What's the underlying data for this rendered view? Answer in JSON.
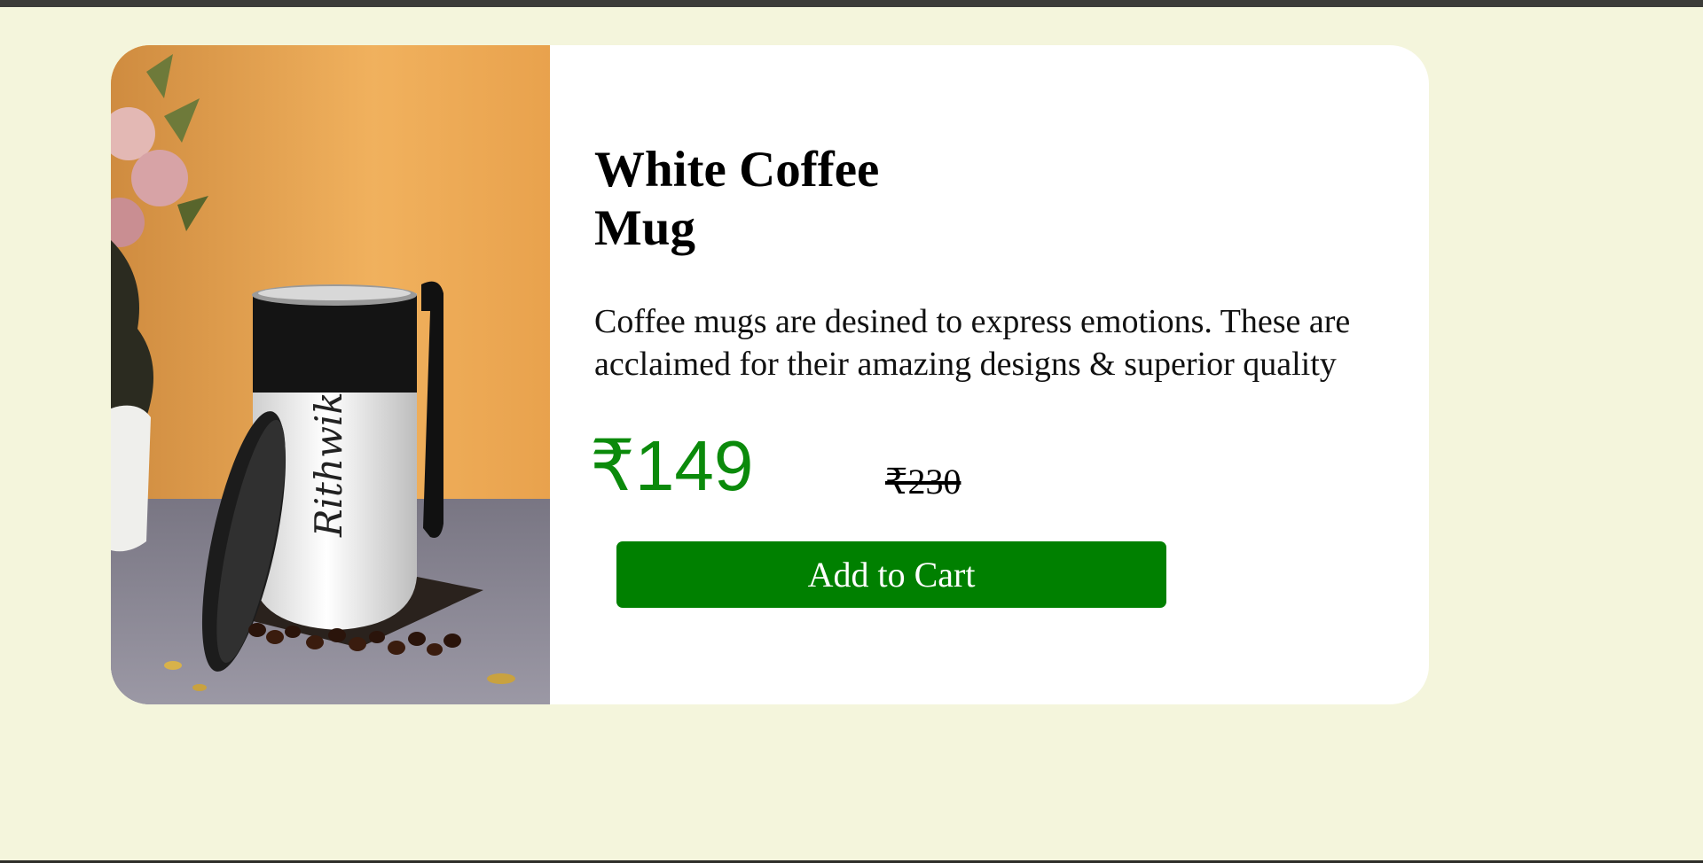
{
  "product": {
    "title": "White Coffee Mug",
    "description": "Coffee mugs are desined to express emotions. These are acclaimed for their amazing designs & superior quality",
    "price": "₹149",
    "old_price": "₹230",
    "add_to_cart_label": "Add to Cart",
    "image_subject": "white-coffee-mug-photo"
  },
  "colors": {
    "page_background": "#f4f5dc",
    "card_background": "#ffffff",
    "price_green": "#0b8a0b",
    "button_green": "#008000"
  }
}
